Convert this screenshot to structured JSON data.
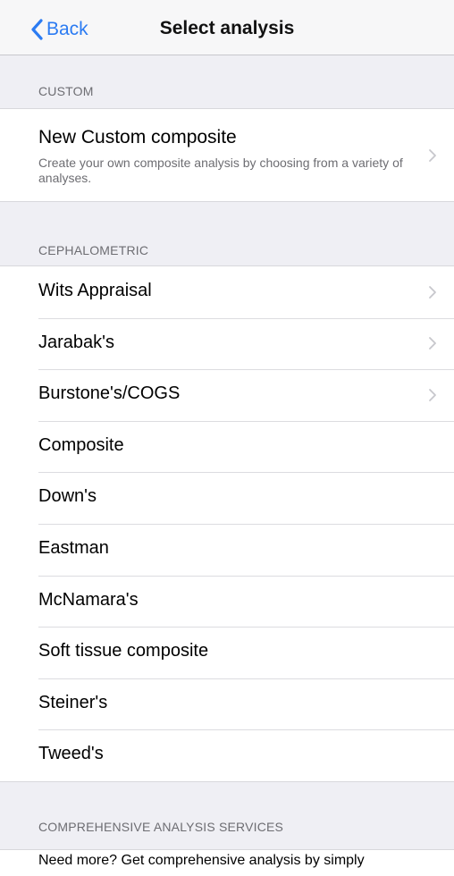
{
  "navbar": {
    "back_label": "Back",
    "title": "Select analysis"
  },
  "sections": {
    "custom": {
      "header": "CUSTOM",
      "item_title": "New Custom composite",
      "item_subtitle": "Create your own composite analysis by choosing from a variety of analyses."
    },
    "cephalometric": {
      "header": "CEPHALOMETRIC",
      "items": [
        {
          "label": "Wits Appraisal",
          "chevron": true
        },
        {
          "label": "Jarabak's",
          "chevron": true
        },
        {
          "label": "Burstone's/COGS",
          "chevron": true
        },
        {
          "label": "Composite",
          "chevron": false
        },
        {
          "label": "Down's",
          "chevron": false
        },
        {
          "label": "Eastman",
          "chevron": false
        },
        {
          "label": "McNamara's",
          "chevron": false
        },
        {
          "label": "Soft tissue composite",
          "chevron": false
        },
        {
          "label": "Steiner's",
          "chevron": false
        },
        {
          "label": "Tweed's",
          "chevron": false
        }
      ]
    },
    "comprehensive": {
      "header": "COMPREHENSIVE ANALYSIS SERVICES",
      "text": "Need more? Get comprehensive analysis by simply"
    }
  },
  "colors": {
    "accent": "#2b7bf2",
    "background": "#efeff4",
    "secondary_text": "#6d6d72"
  },
  "icons": {
    "back": "chevron-left-icon",
    "disclosure": "chevron-right-icon"
  }
}
